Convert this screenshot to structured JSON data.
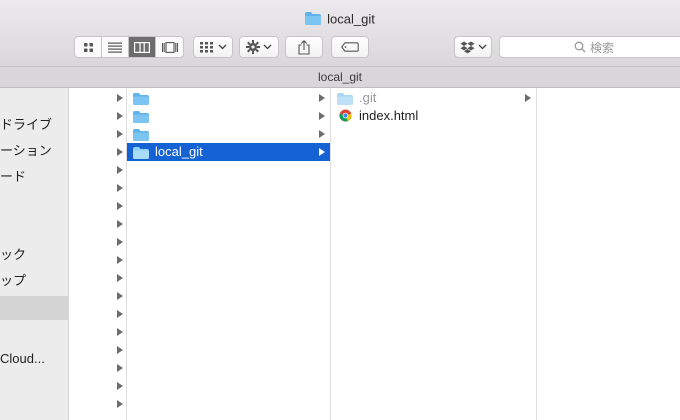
{
  "window": {
    "title": "local_git"
  },
  "toolbar": {
    "search_placeholder": "検索"
  },
  "pathbar": {
    "label": "local_git"
  },
  "sidebar": {
    "items": [
      {
        "label": "ドライブ",
        "selected": false
      },
      {
        "label": "ーション",
        "selected": false
      },
      {
        "label": "ード",
        "selected": false
      },
      {
        "label": "ック",
        "selected": false
      },
      {
        "label": "ップ",
        "selected": false
      },
      {
        "label": "",
        "selected": true
      },
      {
        "label": "Cloud...",
        "selected": false
      }
    ]
  },
  "columns": {
    "col1": {
      "rows": [
        {
          "label": "",
          "selected": false
        },
        {
          "label": "",
          "selected": false
        },
        {
          "label": "",
          "selected": false
        },
        {
          "label": "local_git",
          "selected": true
        }
      ]
    },
    "col2": {
      "rows": [
        {
          "label": ".git",
          "icon": "folder-icon",
          "dim": true
        },
        {
          "label": "index.html",
          "icon": "chrome-html-icon",
          "dim": false
        }
      ]
    }
  },
  "colors": {
    "selection": "#1462d3",
    "folder": "#6ab8ec",
    "toolbar_bg": "#e3e1e3"
  }
}
